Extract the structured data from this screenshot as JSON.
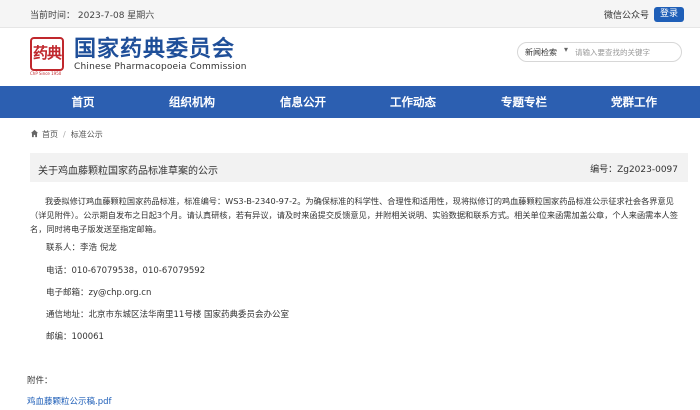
{
  "topbar": {
    "date": "当前时间： 2023-7-08 星期六",
    "wechat": "微信公众号",
    "login": "登录"
  },
  "header": {
    "logo_glyph": "药典",
    "logo_sub": "ChP Since 1950",
    "title": "国家药典委员会",
    "subtitle": "Chinese Pharmacopoeia Commission"
  },
  "search": {
    "scope": "新闻检索",
    "placeholder": "请输入要查找的关键字"
  },
  "nav": {
    "items": [
      "首页",
      "组织机构",
      "信息公开",
      "工作动态",
      "专题专栏",
      "党群工作"
    ]
  },
  "breadcrumb": {
    "home": "首页",
    "current": "标准公示"
  },
  "article": {
    "title": "关于鸡血藤颗粒国家药品标准草案的公示",
    "code": "编号：Zg2023-0097",
    "paragraph": "我委拟修订鸡血藤颗粒国家药品标准，标准编号：WS3-B-2340-97-2。为确保标准的科学性、合理性和适用性，现将拟修订的鸡血藤颗粒国家药品标准公示征求社会各界意见（详见附件）。公示期自发布之日起3个月。请认真研核，若有异议，请及时来函提交反馈意见，并附相关说明、实验数据和联系方式。相关单位来函需加盖公章，个人来函需本人签名，同时将电子版发送至指定邮箱。",
    "contact": "联系人：李浩 倪龙",
    "phone": "电话：010-67079538，010-67079592",
    "email": "电子邮箱：zy@chp.org.cn",
    "address": "通信地址：北京市东城区法华南里11号楼 国家药典委员会办公室",
    "postcode": "邮编：100061",
    "attachment_label": "附件：",
    "attachment_link": "鸡血藤颗粒公示稿.pdf"
  },
  "colors": {
    "brand_blue": "#2c5fb1",
    "title_blue": "#1f4f99",
    "logo_red": "#c0282d",
    "link_blue": "#1f5fb8"
  }
}
